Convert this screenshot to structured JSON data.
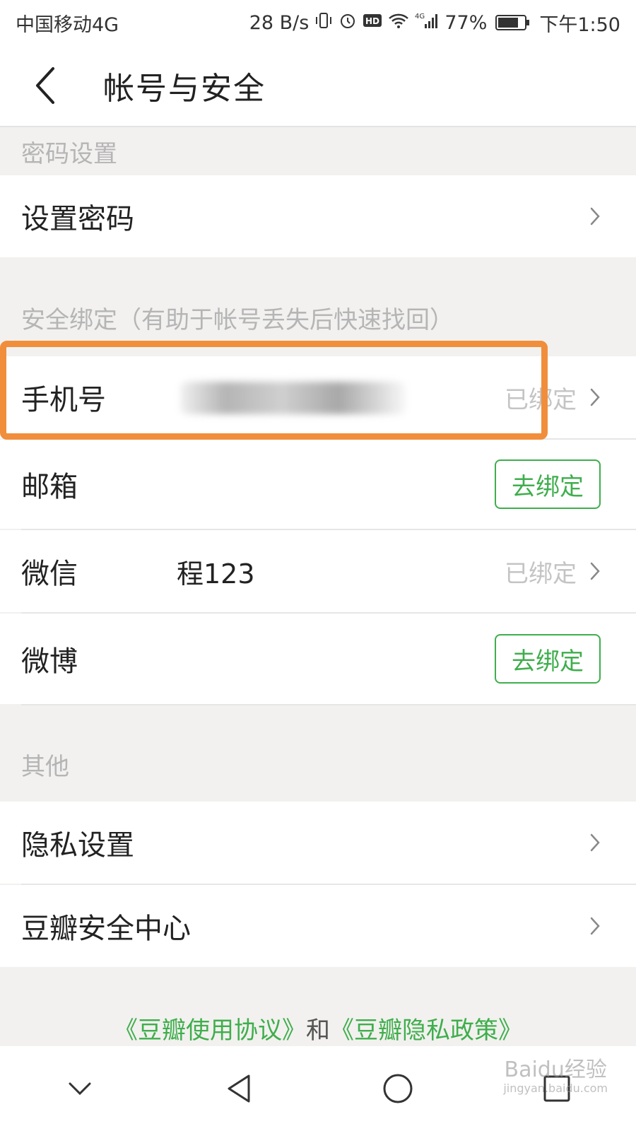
{
  "status_bar": {
    "carrier": "中国移动4G",
    "speed": "28 B/s",
    "network": "4G",
    "battery": "77%",
    "battery_level": 0.77,
    "time": "下午1:50",
    "icons": [
      "vibrate-icon",
      "alarm-icon",
      "hd-icon",
      "wifi-icon",
      "signal-icon",
      "battery-icon"
    ]
  },
  "header": {
    "title": "帐号与安全",
    "back_icon": "chevron-left-icon"
  },
  "sections": {
    "password": {
      "header": "密码设置",
      "items": [
        {
          "label": "设置密码"
        }
      ]
    },
    "binding": {
      "header": "安全绑定（有助于帐号丢失后快速找回）",
      "items": [
        {
          "label": "手机号",
          "value": "",
          "status": "已绑定"
        },
        {
          "label": "邮箱",
          "button": "去绑定"
        },
        {
          "label": "微信",
          "value": "程123",
          "status": "已绑定"
        },
        {
          "label": "微博",
          "button": "去绑定"
        }
      ]
    },
    "other": {
      "header": "其他",
      "items": [
        {
          "label": "隐私设置"
        },
        {
          "label": "豆瓣安全中心"
        }
      ]
    }
  },
  "footer": {
    "terms_link": "《豆瓣使用协议》",
    "and": "和",
    "privacy_link": "《豆瓣隐私政策》"
  },
  "watermark": {
    "brand": "Baidu经验",
    "url": "jingyan.baidu.com"
  },
  "colors": {
    "accent": "#3fae4c",
    "highlight": "#f08e3c",
    "muted": "#b5b5b5",
    "background": "#f2f1ef"
  }
}
